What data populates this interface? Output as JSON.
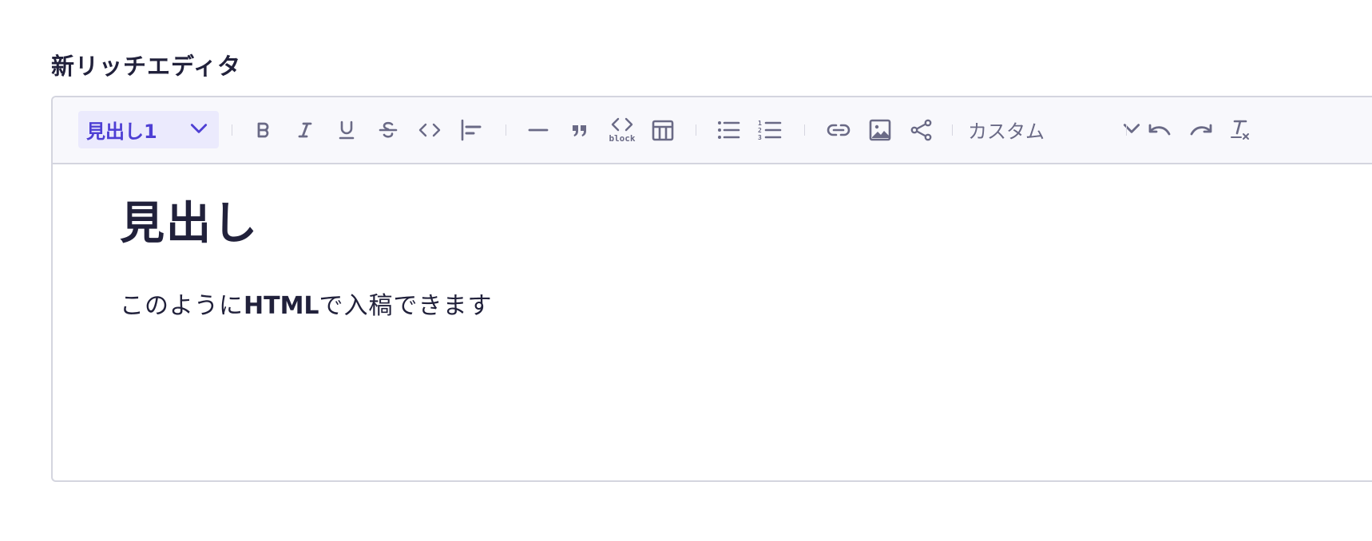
{
  "field": {
    "label": "新リッチエディタ"
  },
  "toolbar": {
    "heading_select": {
      "value": "見出し1"
    },
    "block_code_label": "block",
    "custom_select": {
      "value": "カスタム"
    },
    "icons": [
      "bold-icon",
      "italic-icon",
      "underline-icon",
      "strikethrough-icon",
      "code-icon",
      "align-left-icon",
      "horizontal-rule-icon",
      "quote-icon",
      "code-block-icon",
      "table-icon",
      "bullet-list-icon",
      "ordered-list-icon",
      "link-icon",
      "image-icon",
      "embed-icon",
      "undo-icon",
      "redo-icon",
      "clear-format-icon"
    ]
  },
  "content": {
    "heading": "見出し",
    "paragraph": {
      "before": "このように",
      "bold": "HTML",
      "after": "で入稿できます"
    }
  },
  "colors": {
    "accent": "#4e3fd4",
    "accent_bg": "#ebeafd",
    "icon": "#6a6a86",
    "text": "#21213b",
    "border": "#d4d5df",
    "toolbar_bg": "#f8f8fc"
  }
}
